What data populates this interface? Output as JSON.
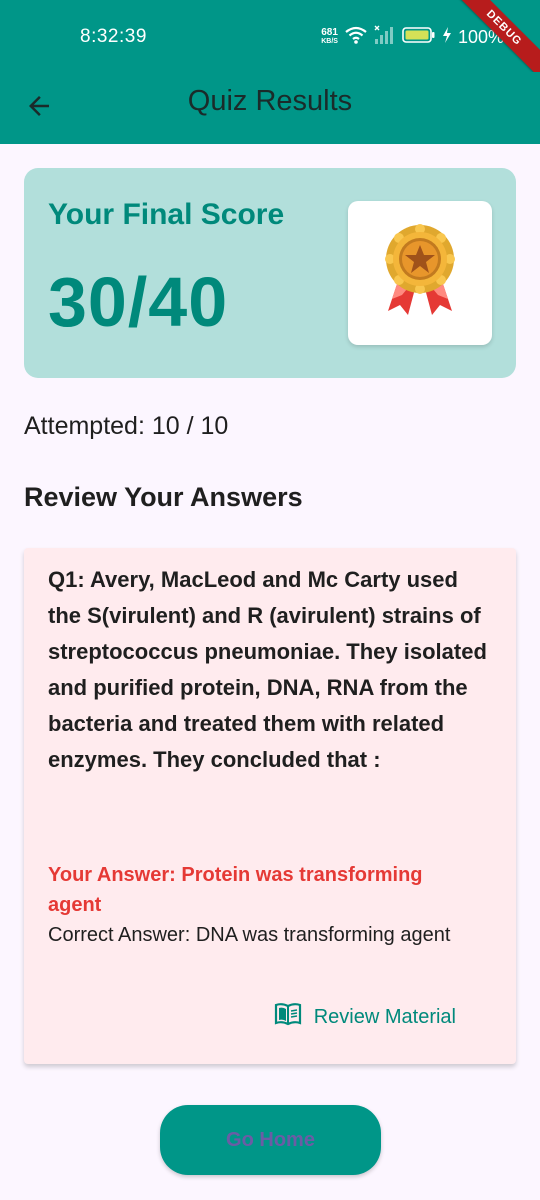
{
  "status_bar": {
    "time": "8:32:39",
    "net_speed_value": "681",
    "net_speed_unit": "KB/S",
    "battery": "100%",
    "debug_label": "DEBUG"
  },
  "app_bar": {
    "title": "Quiz Results",
    "back_icon": "arrow-back-icon"
  },
  "score_card": {
    "label": "Your Final Score",
    "score": "30/40",
    "badge_icon": "award-medal-icon"
  },
  "attempted": "Attempted: 10 / 10",
  "review_section": {
    "title": "Review Your Answers",
    "items": [
      {
        "question": "Q1: Avery, MacLeod and Mc Carty used the S(virulent) and R (avirulent) strains of streptococcus pneumoniae. They isolated and purified protein, DNA, RNA from the bacteria and treated them with related enzymes. They concluded that :",
        "your_answer": "Your Answer: Protein was transforming agent",
        "correct_answer": "Correct Answer: DNA was transforming agent",
        "review_label": "Review Material",
        "review_icon": "menu-book-icon"
      }
    ]
  },
  "go_home_label": "Go Home",
  "colors": {
    "primary": "#009688",
    "score_card_bg": "#b2dfdb",
    "score_text": "#00897b",
    "wrong_card_bg": "#ffebee",
    "wrong_answer": "#e53935",
    "page_bg": "#fcf6ff"
  }
}
